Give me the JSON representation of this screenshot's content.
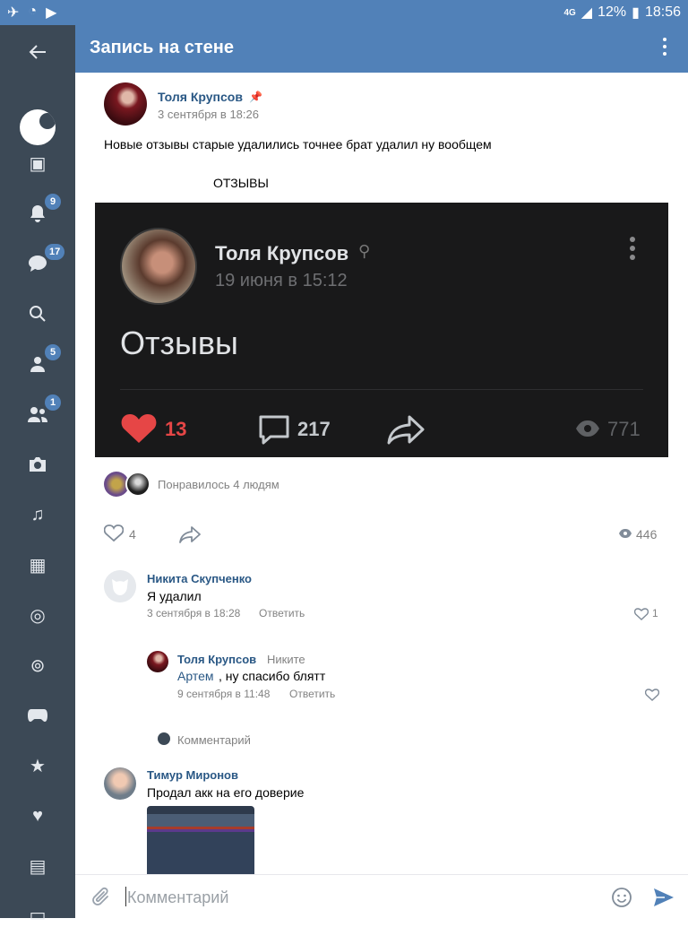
{
  "status_bar": {
    "network": "4G",
    "battery": "12%",
    "time": "18:56"
  },
  "header": {
    "title": "Запись на стене"
  },
  "sidebar": {
    "badges": {
      "notifications": "9",
      "messages": "17",
      "friends": "5",
      "communities": "1"
    }
  },
  "post": {
    "author": "Толя Крупсов",
    "date": "3 сентября в 18:26",
    "text": "Новые отзывы старые удалились точнее брат удалил ну вообщем",
    "subtext": "ОТЗЫВЫ",
    "embed": {
      "author": "Толя Крупсов",
      "date": "19 июня в 15:12",
      "text": "Отзывы",
      "likes": "13",
      "comments": "217",
      "views": "771"
    },
    "liked_by": "Понравилось 4 людям",
    "likes": "4",
    "views": "446"
  },
  "comments": [
    {
      "author": "Никита Скупченко",
      "text": "Я удалил",
      "date": "3 сентября в 18:28",
      "reply_label": "Ответить",
      "likes": "1"
    },
    {
      "author": "Толя Крупсов",
      "reply_to": "Никите",
      "mention": "Артем",
      "text": ", ну спасибо блятт",
      "date": "9 сентября в 11:48",
      "reply_label": "Ответить"
    },
    {
      "author": "Тимур Миронов",
      "text": "Продал акк на его доверие"
    }
  ],
  "reply_placeholder": "Комментарий",
  "composer": {
    "placeholder": "Комментарий"
  },
  "colors": {
    "accent": "#5181b8",
    "sidebar": "#3c4956",
    "link": "#2a5885",
    "like_red": "#e64646"
  }
}
